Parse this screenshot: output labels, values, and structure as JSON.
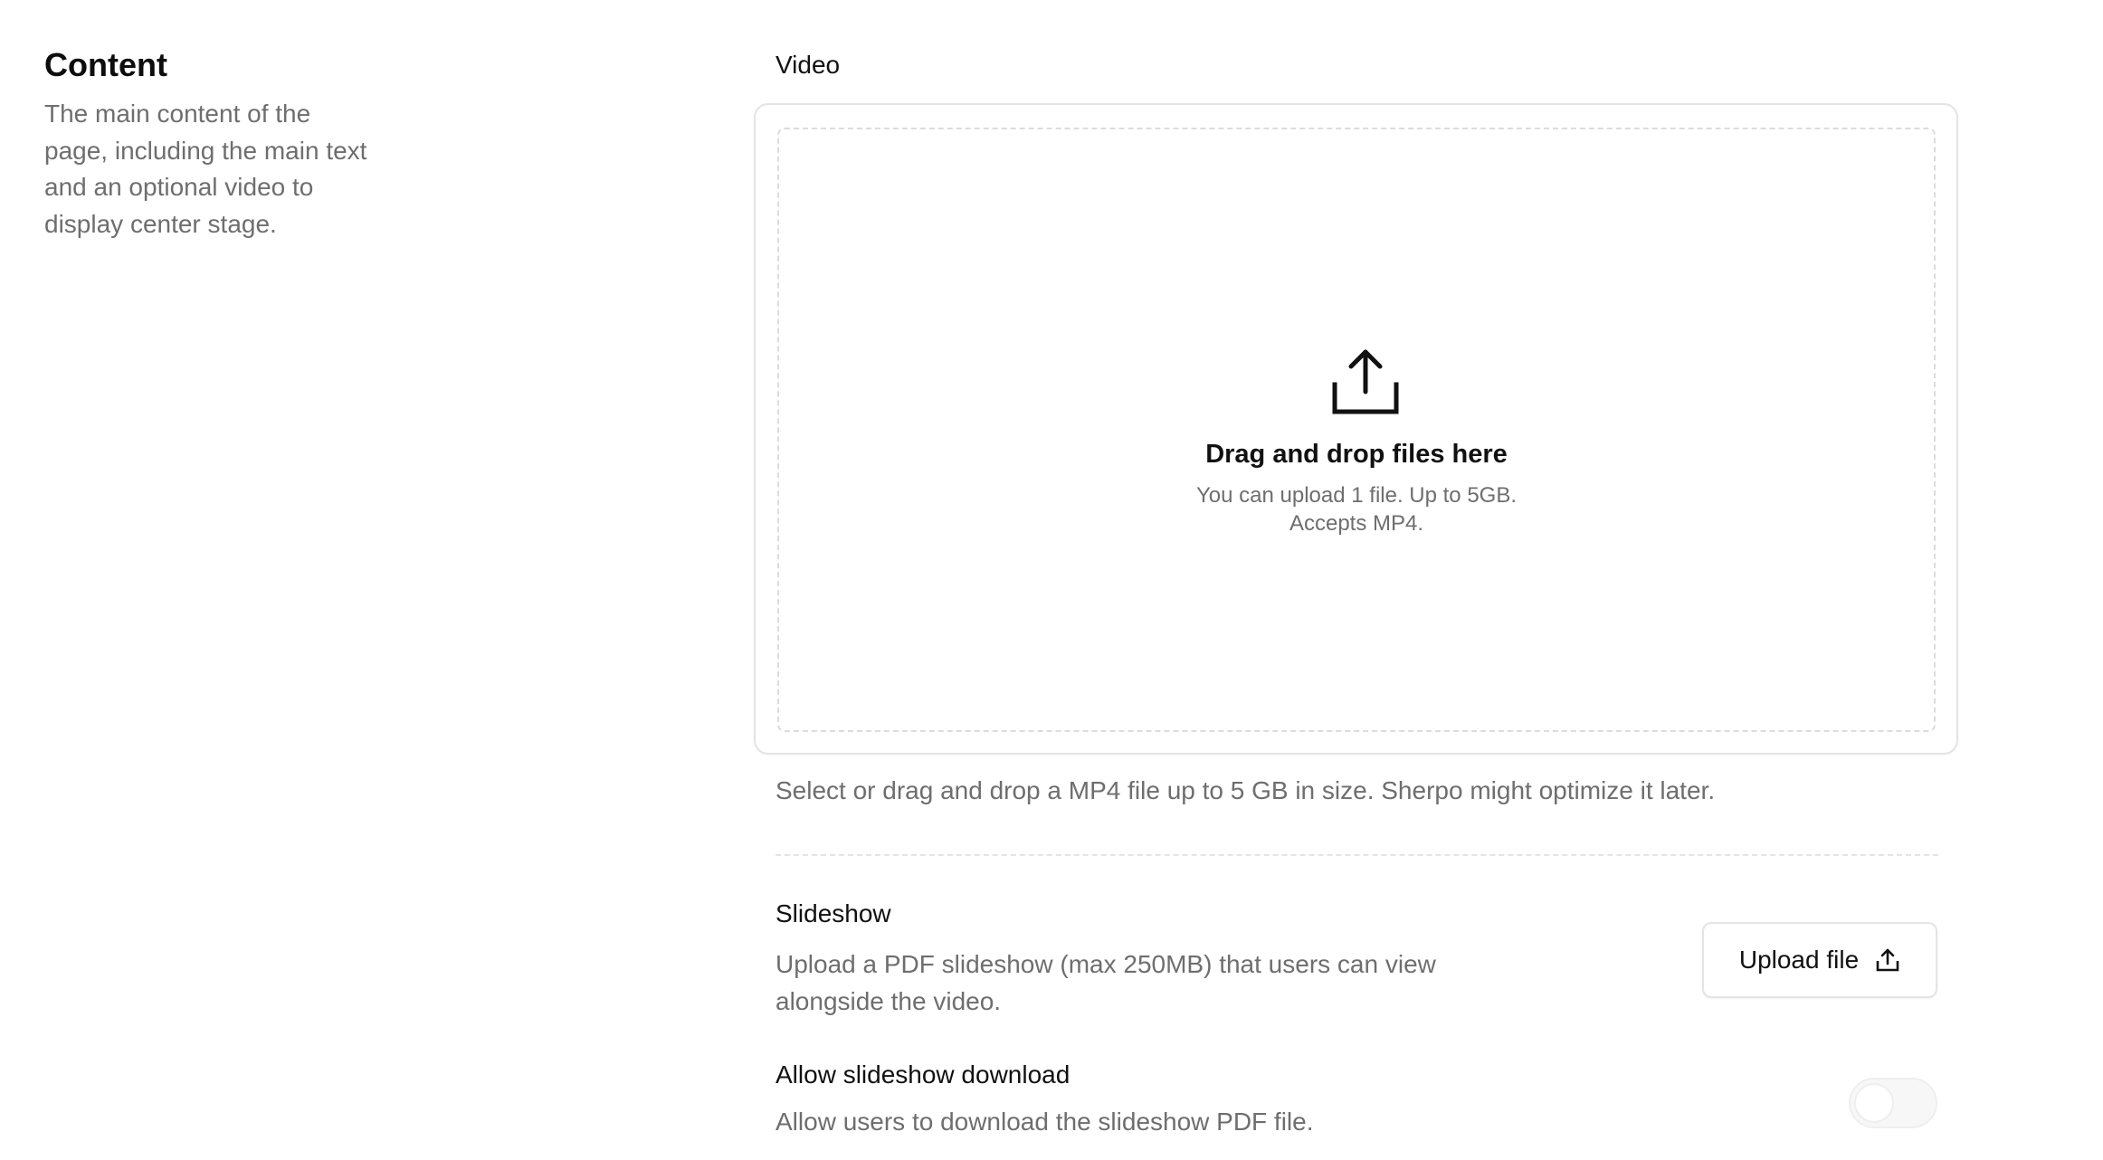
{
  "section": {
    "title": "Content",
    "description": "The main content of the page, including the main text and an optional video to display center stage."
  },
  "video": {
    "label": "Video",
    "dropzone": {
      "icon": "upload-icon",
      "title": "Drag and drop files here",
      "subtitle_line1": "You can upload 1 file. Up to 5GB.",
      "subtitle_line2": "Accepts MP4."
    },
    "help_text": "Select or drag and drop a MP4 file up to 5 GB in size. Sherpo might optimize it later."
  },
  "slideshow": {
    "label": "Slideshow",
    "description": "Upload a PDF slideshow (max 250MB) that users can view alongside the video.",
    "button_label": "Upload file",
    "button_icon": "upload-icon"
  },
  "slideshow_download": {
    "label": "Allow slideshow download",
    "description": "Allow users to download the slideshow PDF file.",
    "enabled": false
  },
  "colors": {
    "text": "#111111",
    "muted": "#6e6e6e",
    "border": "#e4e4e4"
  }
}
